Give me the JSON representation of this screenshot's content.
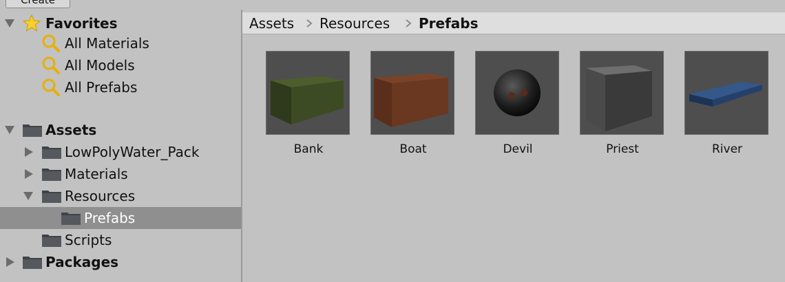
{
  "toolbar": {
    "create_label": "Create"
  },
  "tree": {
    "favorites": {
      "label": "Favorites",
      "items": [
        "All Materials",
        "All Models",
        "All Prefabs"
      ]
    },
    "assets": {
      "label": "Assets",
      "children": [
        {
          "label": "LowPolyWater_Pack",
          "expanded": false
        },
        {
          "label": "Materials",
          "expanded": false
        },
        {
          "label": "Resources",
          "expanded": true,
          "children": [
            {
              "label": "Prefabs",
              "selected": true
            }
          ]
        },
        {
          "label": "Scripts",
          "expanded": false
        }
      ]
    },
    "packages": {
      "label": "Packages",
      "expanded": false
    }
  },
  "breadcrumb": [
    "Assets",
    "Resources",
    "Prefabs"
  ],
  "assets": [
    {
      "label": "Bank",
      "icon": "bank-prefab-icon",
      "color": "#4a5a30"
    },
    {
      "label": "Boat",
      "icon": "boat-prefab-icon",
      "color": "#6b3a22"
    },
    {
      "label": "Devil",
      "icon": "devil-prefab-icon",
      "color": "#222222"
    },
    {
      "label": "Priest",
      "icon": "priest-prefab-icon",
      "color": "#5a5a5a"
    },
    {
      "label": "River",
      "icon": "river-prefab-icon",
      "color": "#2a4a78"
    }
  ]
}
